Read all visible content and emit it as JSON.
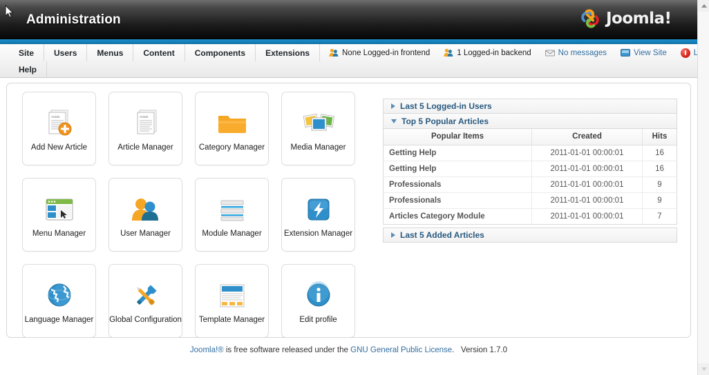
{
  "header": {
    "title": "Administration",
    "logo_text": "Joomla!",
    "logo_icon": "joomla-logo-icon"
  },
  "menu": {
    "row1": [
      {
        "label": "Site"
      },
      {
        "label": "Users"
      },
      {
        "label": "Menus"
      },
      {
        "label": "Content"
      },
      {
        "label": "Components"
      },
      {
        "label": "Extensions"
      }
    ],
    "row2": [
      {
        "label": "Help"
      }
    ]
  },
  "status": [
    {
      "label": "None Logged-in frontend",
      "icon": "users-icon",
      "type": "plain"
    },
    {
      "label": "1 Logged-in backend",
      "icon": "users-icon",
      "type": "plain"
    },
    {
      "label": "No messages",
      "icon": "envelope-icon",
      "type": "link"
    },
    {
      "label": "View Site",
      "icon": "monitor-icon",
      "type": "link"
    },
    {
      "label": "Log out",
      "icon": "logout-icon",
      "type": "link"
    }
  ],
  "tiles": [
    {
      "label": "Add New Article",
      "icon": "add-new-article-icon"
    },
    {
      "label": "Article Manager",
      "icon": "article-manager-icon"
    },
    {
      "label": "Category Manager",
      "icon": "category-manager-icon"
    },
    {
      "label": "Media Manager",
      "icon": "media-manager-icon"
    },
    {
      "label": "Menu Manager",
      "icon": "menu-manager-icon"
    },
    {
      "label": "User Manager",
      "icon": "user-manager-icon"
    },
    {
      "label": "Module Manager",
      "icon": "module-manager-icon"
    },
    {
      "label": "Extension Manager",
      "icon": "extension-manager-icon"
    },
    {
      "label": "Language Manager",
      "icon": "language-manager-icon"
    },
    {
      "label": "Global Configuration",
      "icon": "global-configuration-icon"
    },
    {
      "label": "Template Manager",
      "icon": "template-manager-icon"
    },
    {
      "label": "Edit profile",
      "icon": "edit-profile-icon"
    }
  ],
  "panels": {
    "last_logged_in_users": {
      "title": "Last 5 Logged-in Users",
      "expanded": false
    },
    "top_popular_articles": {
      "title": "Top 5 Popular Articles",
      "expanded": true,
      "columns": [
        "Popular Items",
        "Created",
        "Hits"
      ],
      "rows": [
        {
          "title": "Getting Help",
          "created": "2011-01-01 00:00:01",
          "hits": "16"
        },
        {
          "title": "Getting Help",
          "created": "2011-01-01 00:00:01",
          "hits": "16"
        },
        {
          "title": "Professionals",
          "created": "2011-01-01 00:00:01",
          "hits": "9"
        },
        {
          "title": "Professionals",
          "created": "2011-01-01 00:00:01",
          "hits": "9"
        },
        {
          "title": "Articles Category Module",
          "created": "2011-01-01 00:00:01",
          "hits": "7"
        }
      ]
    },
    "last_added_articles": {
      "title": "Last 5 Added Articles",
      "expanded": false
    }
  },
  "footer": {
    "brand": "Joomla!®",
    "text_before": " is free software released under the ",
    "license": "GNU General Public License",
    "text_after": ".",
    "version": "Version 1.7.0"
  },
  "colors": {
    "accent_blue": "#1781bb",
    "link_blue": "#316ea0",
    "panel_title": "#28597f",
    "header_dark": "#1d1d1d"
  }
}
